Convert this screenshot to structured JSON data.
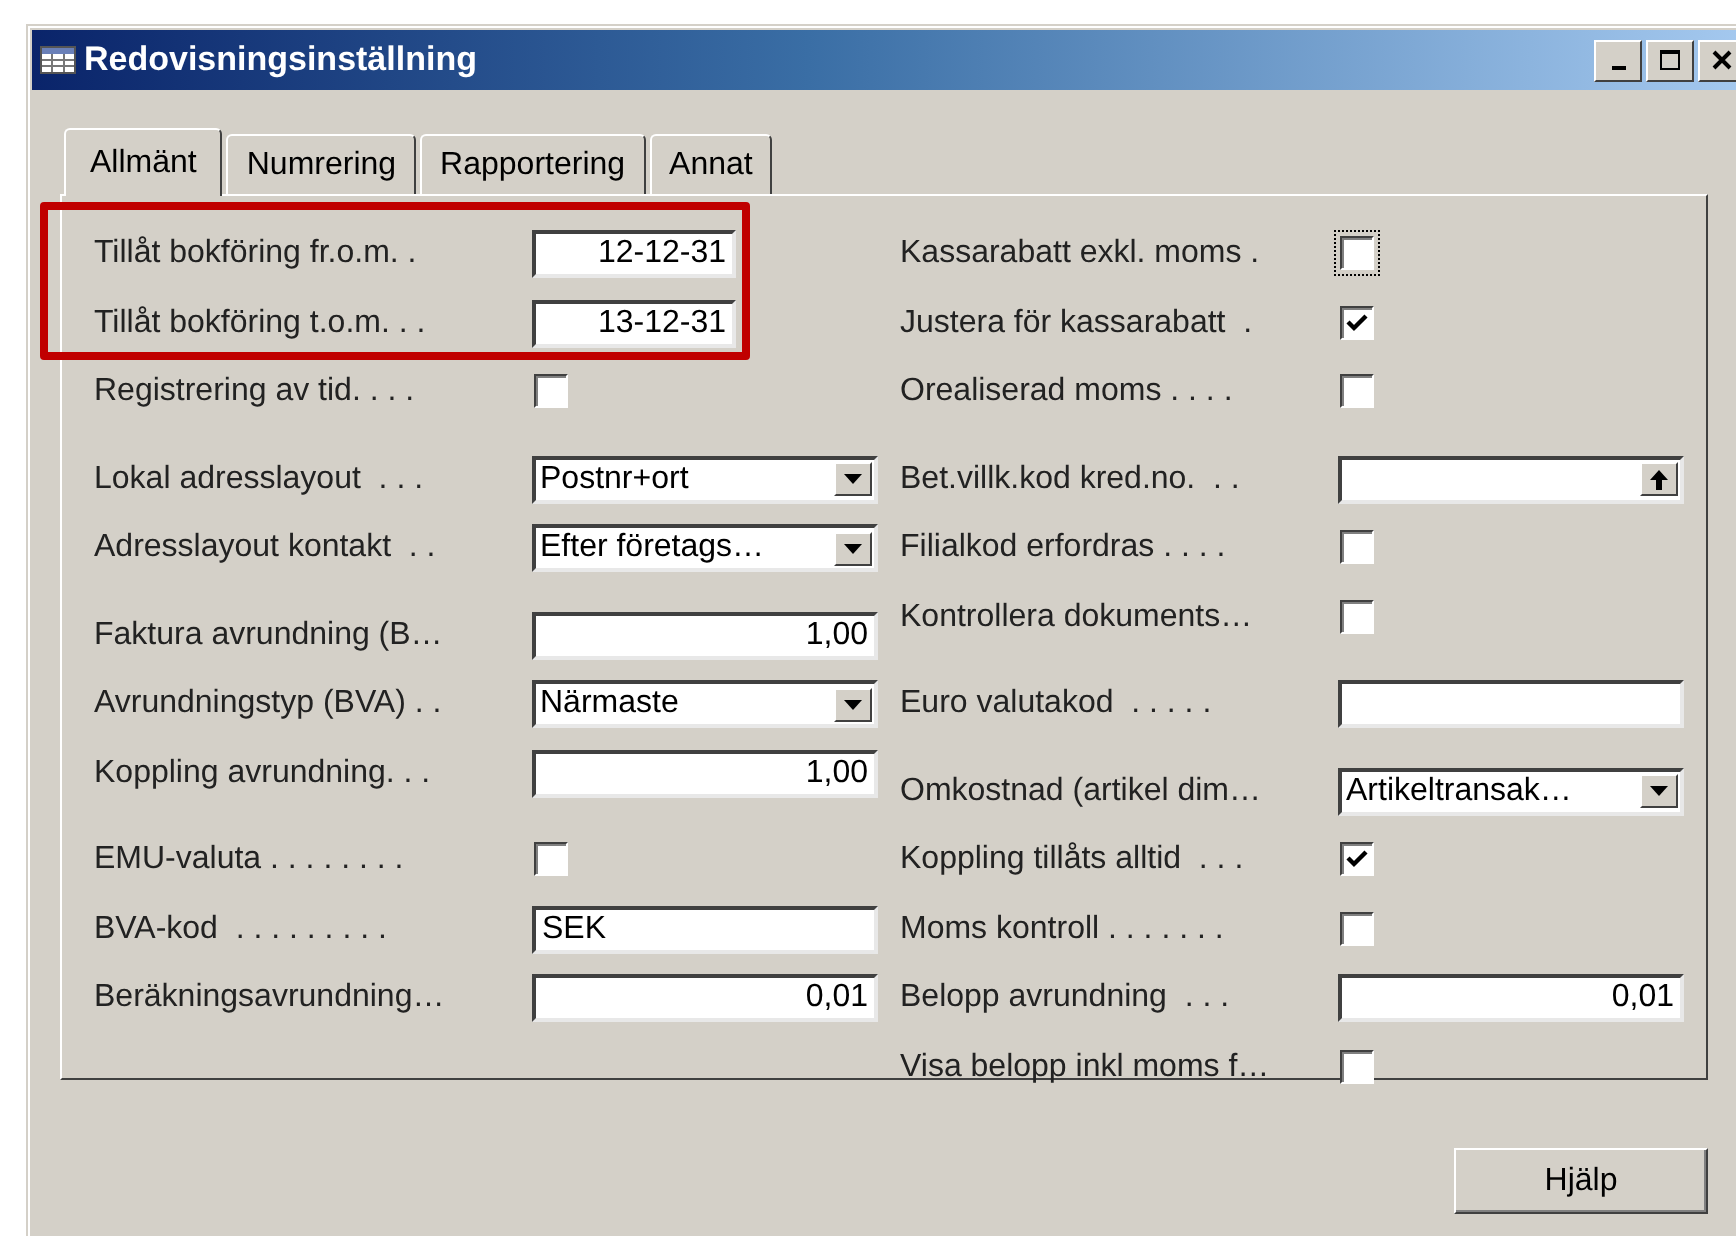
{
  "window": {
    "title": "Redovisningsinställning"
  },
  "tabs": [
    {
      "label": "Allmänt",
      "selected": true
    },
    {
      "label": "Numrering",
      "selected": false
    },
    {
      "label": "Rapportering",
      "selected": false
    },
    {
      "label": "Annat",
      "selected": false
    }
  ],
  "columns": [
    {
      "sections": [
        {
          "blocks": [
            {
              "highlighted": true,
              "fields": [
                {
                  "label": "Tillåt bokföring fr.o.m. .",
                  "kind": "date",
                  "value": "12-12-31"
                },
                {
                  "label": "Tillåt bokföring t.o.m. . .",
                  "kind": "date",
                  "value": "13-12-31"
                }
              ]
            },
            {
              "highlighted": false,
              "fields": [
                {
                  "label": "Registrering av tid. . . .",
                  "kind": "checkbox",
                  "checked": false
                }
              ]
            }
          ]
        },
        {
          "blocks": [
            {
              "highlighted": false,
              "fields": [
                {
                  "label": "Lokal adresslayout  . . .",
                  "kind": "select",
                  "value": "Postnr+ort"
                },
                {
                  "label": "Adresslayout kontakt  . .",
                  "kind": "select",
                  "value": "Efter företags…"
                }
              ]
            }
          ]
        },
        {
          "blocks": [
            {
              "highlighted": false,
              "fields": [
                {
                  "label": "Faktura avrundning (B…",
                  "kind": "number",
                  "value": "1,00"
                },
                {
                  "label": "Avrundningstyp (BVA) . .",
                  "kind": "select",
                  "value": "Närmaste"
                },
                {
                  "label": "Koppling avrundning. . .",
                  "kind": "number",
                  "value": "1,00"
                }
              ]
            }
          ]
        },
        {
          "blocks": [
            {
              "highlighted": false,
              "fields": [
                {
                  "label": "EMU-valuta . . . . . . . .",
                  "kind": "checkbox",
                  "checked": false
                },
                {
                  "label": "BVA-kod  . . . . . . . . .",
                  "kind": "text",
                  "value": "SEK"
                },
                {
                  "label": "Beräkningsavrundning…",
                  "kind": "number",
                  "value": "0,01"
                }
              ]
            }
          ]
        }
      ]
    },
    {
      "sections": [
        {
          "blocks": [
            {
              "highlighted": false,
              "fields": [
                {
                  "label": "Kassarabatt exkl. moms .",
                  "kind": "checkbox",
                  "checked": false,
                  "focused": true
                },
                {
                  "label": "Justera för kassarabatt  .",
                  "kind": "checkbox",
                  "checked": true
                },
                {
                  "label": "Orealiserad moms . . . .",
                  "kind": "checkbox",
                  "checked": false
                }
              ]
            }
          ]
        },
        {
          "blocks": [
            {
              "highlighted": false,
              "fields": [
                {
                  "label": "Bet.villk.kod kred.no.  . .",
                  "kind": "lookup"
                },
                {
                  "label": "Filialkod erfordras . . . .",
                  "kind": "checkbox",
                  "checked": false
                },
                {
                  "label": "Kontrollera dokuments…",
                  "kind": "checkbox",
                  "checked": false
                }
              ]
            }
          ]
        },
        {
          "blocks": [
            {
              "highlighted": false,
              "fields": [
                {
                  "label": "Euro valutakod  . . . . .",
                  "kind": "text"
                }
              ]
            }
          ]
        },
        {
          "blocks": [
            {
              "highlighted": false,
              "fields": [
                {
                  "label": "Omkostnad (artikel dim…",
                  "kind": "select",
                  "value": "Artikeltransak…"
                },
                {
                  "label": "Koppling tillåts alltid  . . .",
                  "kind": "checkbox",
                  "checked": true
                },
                {
                  "label": "Moms kontroll . . . . . . .",
                  "kind": "checkbox",
                  "checked": false
                },
                {
                  "label": "Belopp avrundning  . . .",
                  "kind": "number",
                  "value": "0,01"
                },
                {
                  "label": "Visa belopp inkl moms f…",
                  "kind": "checkbox",
                  "checked": false
                }
              ]
            }
          ]
        }
      ]
    }
  ],
  "buttons": [
    {
      "label": "Hjälp"
    }
  ]
}
